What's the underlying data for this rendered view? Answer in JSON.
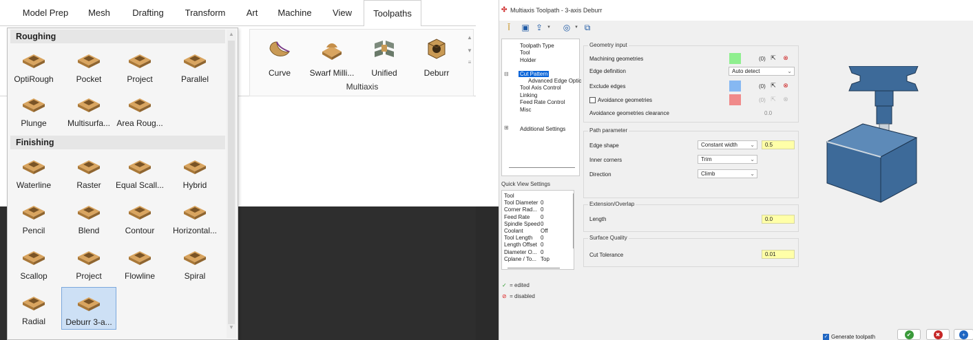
{
  "menu": {
    "tabs": [
      "Model Prep",
      "Mesh",
      "Drafting",
      "Transform",
      "Art",
      "Machine",
      "View",
      "Toolpaths"
    ],
    "active_tab": "Toolpaths"
  },
  "ribbon": {
    "group_label": "Multiaxis",
    "items": [
      {
        "label": "Curve",
        "icon": "curve-icon"
      },
      {
        "label": "Swarf Milli...",
        "icon": "swarf-icon"
      },
      {
        "label": "Unified",
        "icon": "unified-icon"
      },
      {
        "label": "Deburr",
        "icon": "deburr-icon"
      }
    ]
  },
  "panel": {
    "roughing_label": "Roughing",
    "roughing": [
      "OptiRough",
      "Pocket",
      "Project",
      "Parallel",
      "Plunge",
      "Multisurfa...",
      "Area Roug..."
    ],
    "finishing_label": "Finishing",
    "finishing": [
      "Waterline",
      "Raster",
      "Equal Scall...",
      "Hybrid",
      "Pencil",
      "Blend",
      "Contour",
      "Horizontal...",
      "Scallop",
      "Project",
      "Flowline",
      "Spiral",
      "Radial",
      "Deburr 3-a..."
    ],
    "selected": "Deburr 3-a..."
  },
  "dialog": {
    "title": "Multiaxis Toolpath - 3-axis Deburr",
    "tree": [
      "Toolpath Type",
      "Tool",
      "Holder",
      "Cut Pattern",
      "Advanced Edge Optic",
      "Tool Axis Control",
      "Linking",
      "Feed Rate Control",
      "Misc",
      "Additional Settings"
    ],
    "tree_selected": "Cut Pattern",
    "quick_view_label": "Quick View Settings",
    "quick_view": [
      {
        "k": "Tool",
        "v": ""
      },
      {
        "k": "Tool Diameter",
        "v": "0"
      },
      {
        "k": "Corner Rad...",
        "v": "0"
      },
      {
        "k": "Feed Rate",
        "v": "0"
      },
      {
        "k": "Spindle Speed",
        "v": "0"
      },
      {
        "k": "Coolant",
        "v": "Off"
      },
      {
        "k": "Tool Length",
        "v": "0"
      },
      {
        "k": "Length Offset",
        "v": "0"
      },
      {
        "k": "Diameter O...",
        "v": "0"
      },
      {
        "k": "Cplane / To...",
        "v": "Top"
      }
    ],
    "legend_edited": "= edited",
    "legend_disabled": "= disabled",
    "geometry": {
      "title": "Geometry input",
      "machining_label": "Machining geometries",
      "machining_count": "(0)",
      "edge_def_label": "Edge definition",
      "edge_def_value": "Auto detect",
      "exclude_label": "Exclude edges",
      "exclude_count": "(0)",
      "avoid_label": "Avoidance geometries",
      "avoid_count": "(0)",
      "clearance_label": "Avoidance geometries clearance",
      "clearance_value": "0.0"
    },
    "path": {
      "title": "Path parameter",
      "edge_shape_label": "Edge shape",
      "edge_shape_value": "Constant width",
      "edge_shape_num": "0.5",
      "inner_label": "Inner corners",
      "inner_value": "Trim",
      "direction_label": "Direction",
      "direction_value": "Climb"
    },
    "extension": {
      "title": "Extension/Overlap",
      "length_label": "Length",
      "length_value": "0.0"
    },
    "quality": {
      "title": "Surface Quality",
      "tol_label": "Cut Tolerance",
      "tol_value": "0.01"
    },
    "generate_label": "Generate toolpath",
    "colors": {
      "green": "#8fef8f",
      "blue": "#86b8f2",
      "red": "#f08a8a",
      "selection": "#0a64d8",
      "part": "#3d6a99"
    }
  }
}
